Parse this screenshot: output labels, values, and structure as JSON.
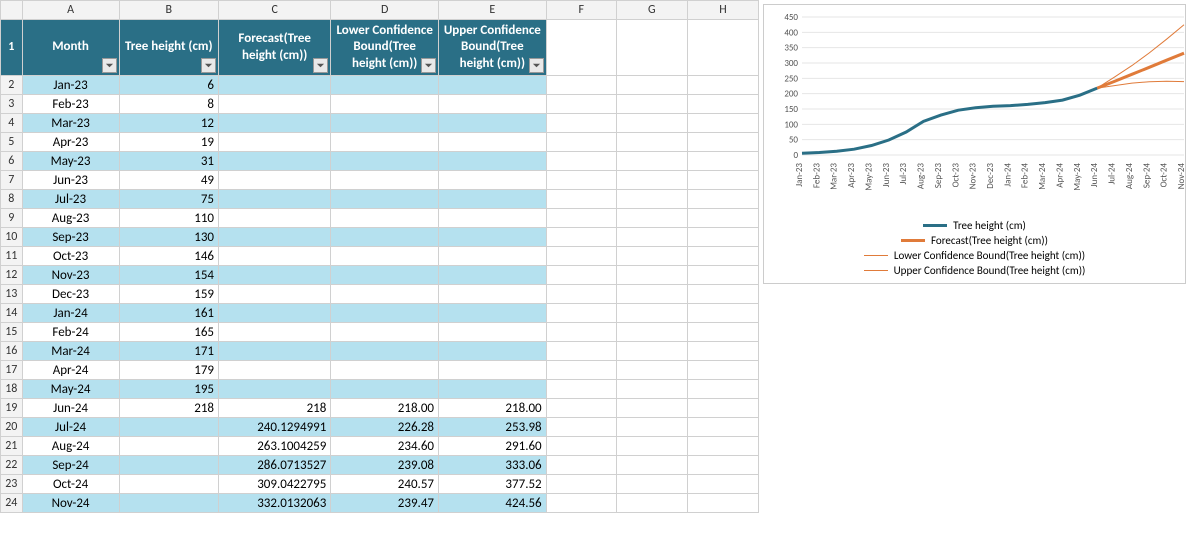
{
  "columns": {
    "letters": [
      "A",
      "B",
      "C",
      "D",
      "E",
      "F",
      "G",
      "H"
    ],
    "widths": [
      140,
      150,
      140,
      140,
      140,
      120,
      120,
      120
    ]
  },
  "headers": {
    "A": "Month",
    "B": "Tree height (cm)",
    "C": "Forecast(Tree height (cm))",
    "D": "Lower Confidence Bound(Tree height (cm))",
    "E": "Upper Confidence Bound(Tree height (cm))"
  },
  "rows": [
    {
      "n": 2,
      "month": "Jan-23",
      "th": "6",
      "fc": "",
      "lb": "",
      "ub": ""
    },
    {
      "n": 3,
      "month": "Feb-23",
      "th": "8",
      "fc": "",
      "lb": "",
      "ub": ""
    },
    {
      "n": 4,
      "month": "Mar-23",
      "th": "12",
      "fc": "",
      "lb": "",
      "ub": ""
    },
    {
      "n": 5,
      "month": "Apr-23",
      "th": "19",
      "fc": "",
      "lb": "",
      "ub": ""
    },
    {
      "n": 6,
      "month": "May-23",
      "th": "31",
      "fc": "",
      "lb": "",
      "ub": ""
    },
    {
      "n": 7,
      "month": "Jun-23",
      "th": "49",
      "fc": "",
      "lb": "",
      "ub": ""
    },
    {
      "n": 8,
      "month": "Jul-23",
      "th": "75",
      "fc": "",
      "lb": "",
      "ub": ""
    },
    {
      "n": 9,
      "month": "Aug-23",
      "th": "110",
      "fc": "",
      "lb": "",
      "ub": ""
    },
    {
      "n": 10,
      "month": "Sep-23",
      "th": "130",
      "fc": "",
      "lb": "",
      "ub": ""
    },
    {
      "n": 11,
      "month": "Oct-23",
      "th": "146",
      "fc": "",
      "lb": "",
      "ub": ""
    },
    {
      "n": 12,
      "month": "Nov-23",
      "th": "154",
      "fc": "",
      "lb": "",
      "ub": ""
    },
    {
      "n": 13,
      "month": "Dec-23",
      "th": "159",
      "fc": "",
      "lb": "",
      "ub": ""
    },
    {
      "n": 14,
      "month": "Jan-24",
      "th": "161",
      "fc": "",
      "lb": "",
      "ub": ""
    },
    {
      "n": 15,
      "month": "Feb-24",
      "th": "165",
      "fc": "",
      "lb": "",
      "ub": ""
    },
    {
      "n": 16,
      "month": "Mar-24",
      "th": "171",
      "fc": "",
      "lb": "",
      "ub": ""
    },
    {
      "n": 17,
      "month": "Apr-24",
      "th": "179",
      "fc": "",
      "lb": "",
      "ub": ""
    },
    {
      "n": 18,
      "month": "May-24",
      "th": "195",
      "fc": "",
      "lb": "",
      "ub": ""
    },
    {
      "n": 19,
      "month": "Jun-24",
      "th": "218",
      "fc": "218",
      "lb": "218.00",
      "ub": "218.00"
    },
    {
      "n": 20,
      "month": "Jul-24",
      "th": "",
      "fc": "240.1294991",
      "lb": "226.28",
      "ub": "253.98"
    },
    {
      "n": 21,
      "month": "Aug-24",
      "th": "",
      "fc": "263.1004259",
      "lb": "234.60",
      "ub": "291.60"
    },
    {
      "n": 22,
      "month": "Sep-24",
      "th": "",
      "fc": "286.0713527",
      "lb": "239.08",
      "ub": "333.06"
    },
    {
      "n": 23,
      "month": "Oct-24",
      "th": "",
      "fc": "309.0422795",
      "lb": "240.57",
      "ub": "377.52"
    },
    {
      "n": 24,
      "month": "Nov-24",
      "th": "",
      "fc": "332.0132063",
      "lb": "239.47",
      "ub": "424.56"
    }
  ],
  "colors": {
    "actual": "#2a6f86",
    "forecast": "#e07b3a",
    "bound": "#e07b3a"
  },
  "chart_data": {
    "type": "line",
    "x": [
      "Jan-23",
      "Feb-23",
      "Mar-23",
      "Apr-23",
      "May-23",
      "Jun-23",
      "Jul-23",
      "Aug-23",
      "Sep-23",
      "Oct-23",
      "Nov-23",
      "Dec-23",
      "Jan-24",
      "Feb-24",
      "Mar-24",
      "Apr-24",
      "May-24",
      "Jun-24",
      "Jul-24",
      "Aug-24",
      "Sep-24",
      "Oct-24",
      "Nov-24"
    ],
    "series": [
      {
        "name": "Tree height (cm)",
        "values": [
          6,
          8,
          12,
          19,
          31,
          49,
          75,
          110,
          130,
          146,
          154,
          159,
          161,
          165,
          171,
          179,
          195,
          218,
          null,
          null,
          null,
          null,
          null
        ],
        "stroke": "#2a6f86",
        "width": 3
      },
      {
        "name": "Forecast(Tree height (cm))",
        "values": [
          null,
          null,
          null,
          null,
          null,
          null,
          null,
          null,
          null,
          null,
          null,
          null,
          null,
          null,
          null,
          null,
          null,
          218,
          240.13,
          263.1,
          286.07,
          309.04,
          332.01
        ],
        "stroke": "#e07b3a",
        "width": 3
      },
      {
        "name": "Lower Confidence Bound(Tree height (cm))",
        "values": [
          null,
          null,
          null,
          null,
          null,
          null,
          null,
          null,
          null,
          null,
          null,
          null,
          null,
          null,
          null,
          null,
          null,
          218,
          226.28,
          234.6,
          239.08,
          240.57,
          239.47
        ],
        "stroke": "#e07b3a",
        "width": 1
      },
      {
        "name": "Upper Confidence Bound(Tree height (cm))",
        "values": [
          null,
          null,
          null,
          null,
          null,
          null,
          null,
          null,
          null,
          null,
          null,
          null,
          null,
          null,
          null,
          null,
          null,
          218,
          253.98,
          291.6,
          333.06,
          377.52,
          424.56
        ],
        "stroke": "#e07b3a",
        "width": 1
      }
    ],
    "ylim": [
      0,
      450
    ],
    "yticks": [
      0,
      50,
      100,
      150,
      200,
      250,
      300,
      350,
      400,
      450
    ],
    "legend_position": "bottom"
  }
}
